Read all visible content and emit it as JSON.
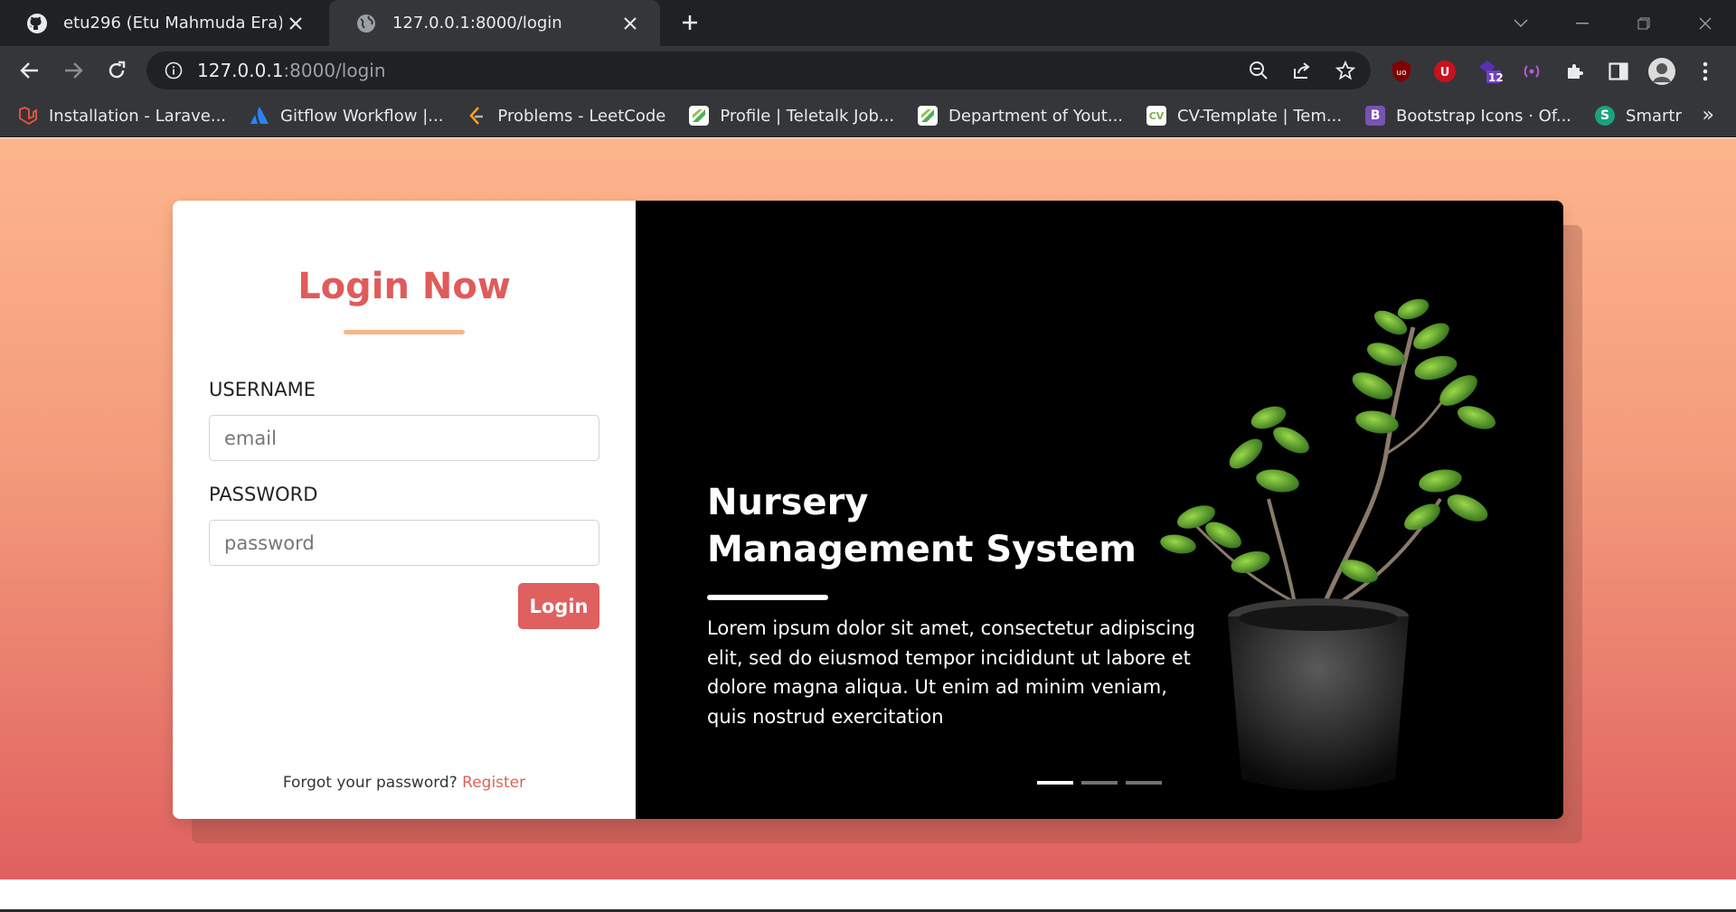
{
  "browser": {
    "tabs": [
      {
        "title": "etu296 (Etu Mahmuda Era)",
        "icon": "github-icon",
        "active": false
      },
      {
        "title": "127.0.0.1:8000/login",
        "icon": "globe-icon",
        "active": true
      }
    ],
    "url": {
      "host": "127.0.0.1",
      "rest": ":8000/login"
    },
    "bookmarks": [
      {
        "label": "Installation - Larave...",
        "icon": "laravel-icon",
        "color": "#f05340"
      },
      {
        "label": "Gitflow Workflow |...",
        "icon": "atlassian-icon",
        "color": "#2684ff"
      },
      {
        "label": "Problems - LeetCode",
        "icon": "leetcode-icon",
        "color": "#ffa116"
      },
      {
        "label": "Profile | Teletalk Job...",
        "icon": "teletalk-icon",
        "color": "#4caf50"
      },
      {
        "label": "Department of Yout...",
        "icon": "teletalk-icon",
        "color": "#4caf50"
      },
      {
        "label": "CV-Template | Tem...",
        "icon": "cv-icon",
        "color": "#7cb342"
      },
      {
        "label": "Bootstrap Icons · Of...",
        "icon": "bootstrap-icon",
        "color": "#7952b3"
      },
      {
        "label": "Smartr",
        "icon": "smartr-icon",
        "color": "#1aa37a"
      }
    ],
    "extension_badge": "12",
    "bookmark_glyphs": {
      "bootstrap": "B",
      "cv": "CV",
      "smartr": "S"
    }
  },
  "login": {
    "title": "Login Now",
    "username_label": "USERNAME",
    "username_placeholder": "email",
    "password_label": "PASSWORD",
    "password_placeholder": "password",
    "button": "Login",
    "forgot_text": "Forgot your password?",
    "register_link": "Register"
  },
  "hero": {
    "title": "Nursery Management System",
    "text": "Lorem ipsum dolor sit amet, consectetur adipiscing elit, sed do eiusmod tempor incididunt ut labore et dolore magna aliqua. Ut enim ad minim veniam, quis nostrud exercitation",
    "slides": 3,
    "active_slide": 0
  },
  "colors": {
    "accent": "#e05f5f",
    "underline": "#f7b488",
    "gradient_top": "#fdb58c",
    "gradient_bottom": "#e0615f"
  }
}
